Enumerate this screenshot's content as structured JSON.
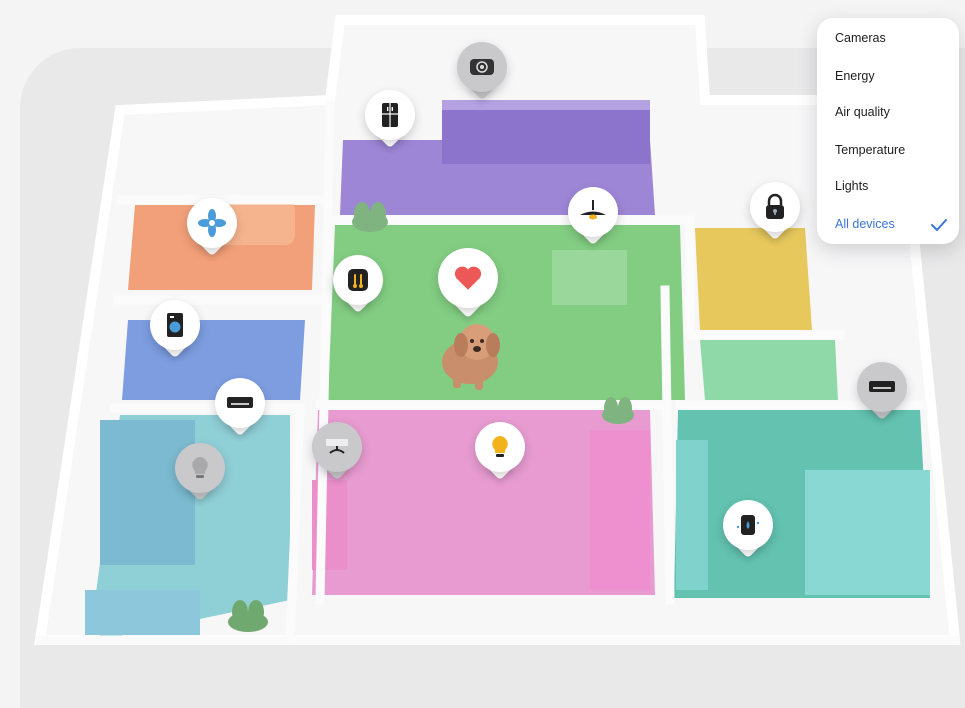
{
  "filter_menu": {
    "items": [
      {
        "label": "Cameras",
        "selected": false
      },
      {
        "label": "Energy",
        "selected": false
      },
      {
        "label": "Air quality",
        "selected": false
      },
      {
        "label": "Temperature",
        "selected": false
      },
      {
        "label": "Lights",
        "selected": false
      },
      {
        "label": "All devices",
        "selected": true
      }
    ],
    "selected_icon": "checkmark-icon",
    "accent_color": "#3a74d6"
  },
  "devices": [
    {
      "name": "robot-vacuum",
      "icon": "robot-vacuum-icon",
      "state": "off"
    },
    {
      "name": "refrigerator",
      "icon": "refrigerator-icon",
      "state": "on"
    },
    {
      "name": "fan",
      "icon": "fan-icon",
      "state": "on"
    },
    {
      "name": "ceiling-lamp",
      "icon": "ceiling-lamp-icon",
      "state": "on"
    },
    {
      "name": "door-lock",
      "icon": "lock-icon",
      "state": "on"
    },
    {
      "name": "climate-control",
      "icon": "thermostat-icon",
      "state": "on"
    },
    {
      "name": "pet-favorite",
      "icon": "heart-icon",
      "state": "on"
    },
    {
      "name": "washing-machine",
      "icon": "washer-icon",
      "state": "on"
    },
    {
      "name": "air-conditioner-bedroom",
      "icon": "air-conditioner-icon",
      "state": "on"
    },
    {
      "name": "air-conditioner-right",
      "icon": "air-conditioner-icon",
      "state": "off"
    },
    {
      "name": "bedroom-light",
      "icon": "light-bulb-icon",
      "state": "off"
    },
    {
      "name": "hallway-ceiling-light",
      "icon": "ceiling-light-icon",
      "state": "off"
    },
    {
      "name": "living-room-light",
      "icon": "light-bulb-icon",
      "state": "on"
    },
    {
      "name": "dehumidifier",
      "icon": "dehumidifier-icon",
      "state": "on"
    }
  ],
  "rooms": [
    {
      "name": "kitchen",
      "color": "#9d86d6"
    },
    {
      "name": "bathroom",
      "color": "#f2a079"
    },
    {
      "name": "laundry",
      "color": "#7d9de0"
    },
    {
      "name": "living-room",
      "color": "#83cd83"
    },
    {
      "name": "bedroom-left",
      "color": "#8fcfd6"
    },
    {
      "name": "lounge",
      "color": "#e79bd0"
    },
    {
      "name": "entry",
      "color": "#e6c85d"
    },
    {
      "name": "hallway-right",
      "color": "#8fd9a9"
    },
    {
      "name": "bedroom-right",
      "color": "#63c2b0"
    }
  ]
}
